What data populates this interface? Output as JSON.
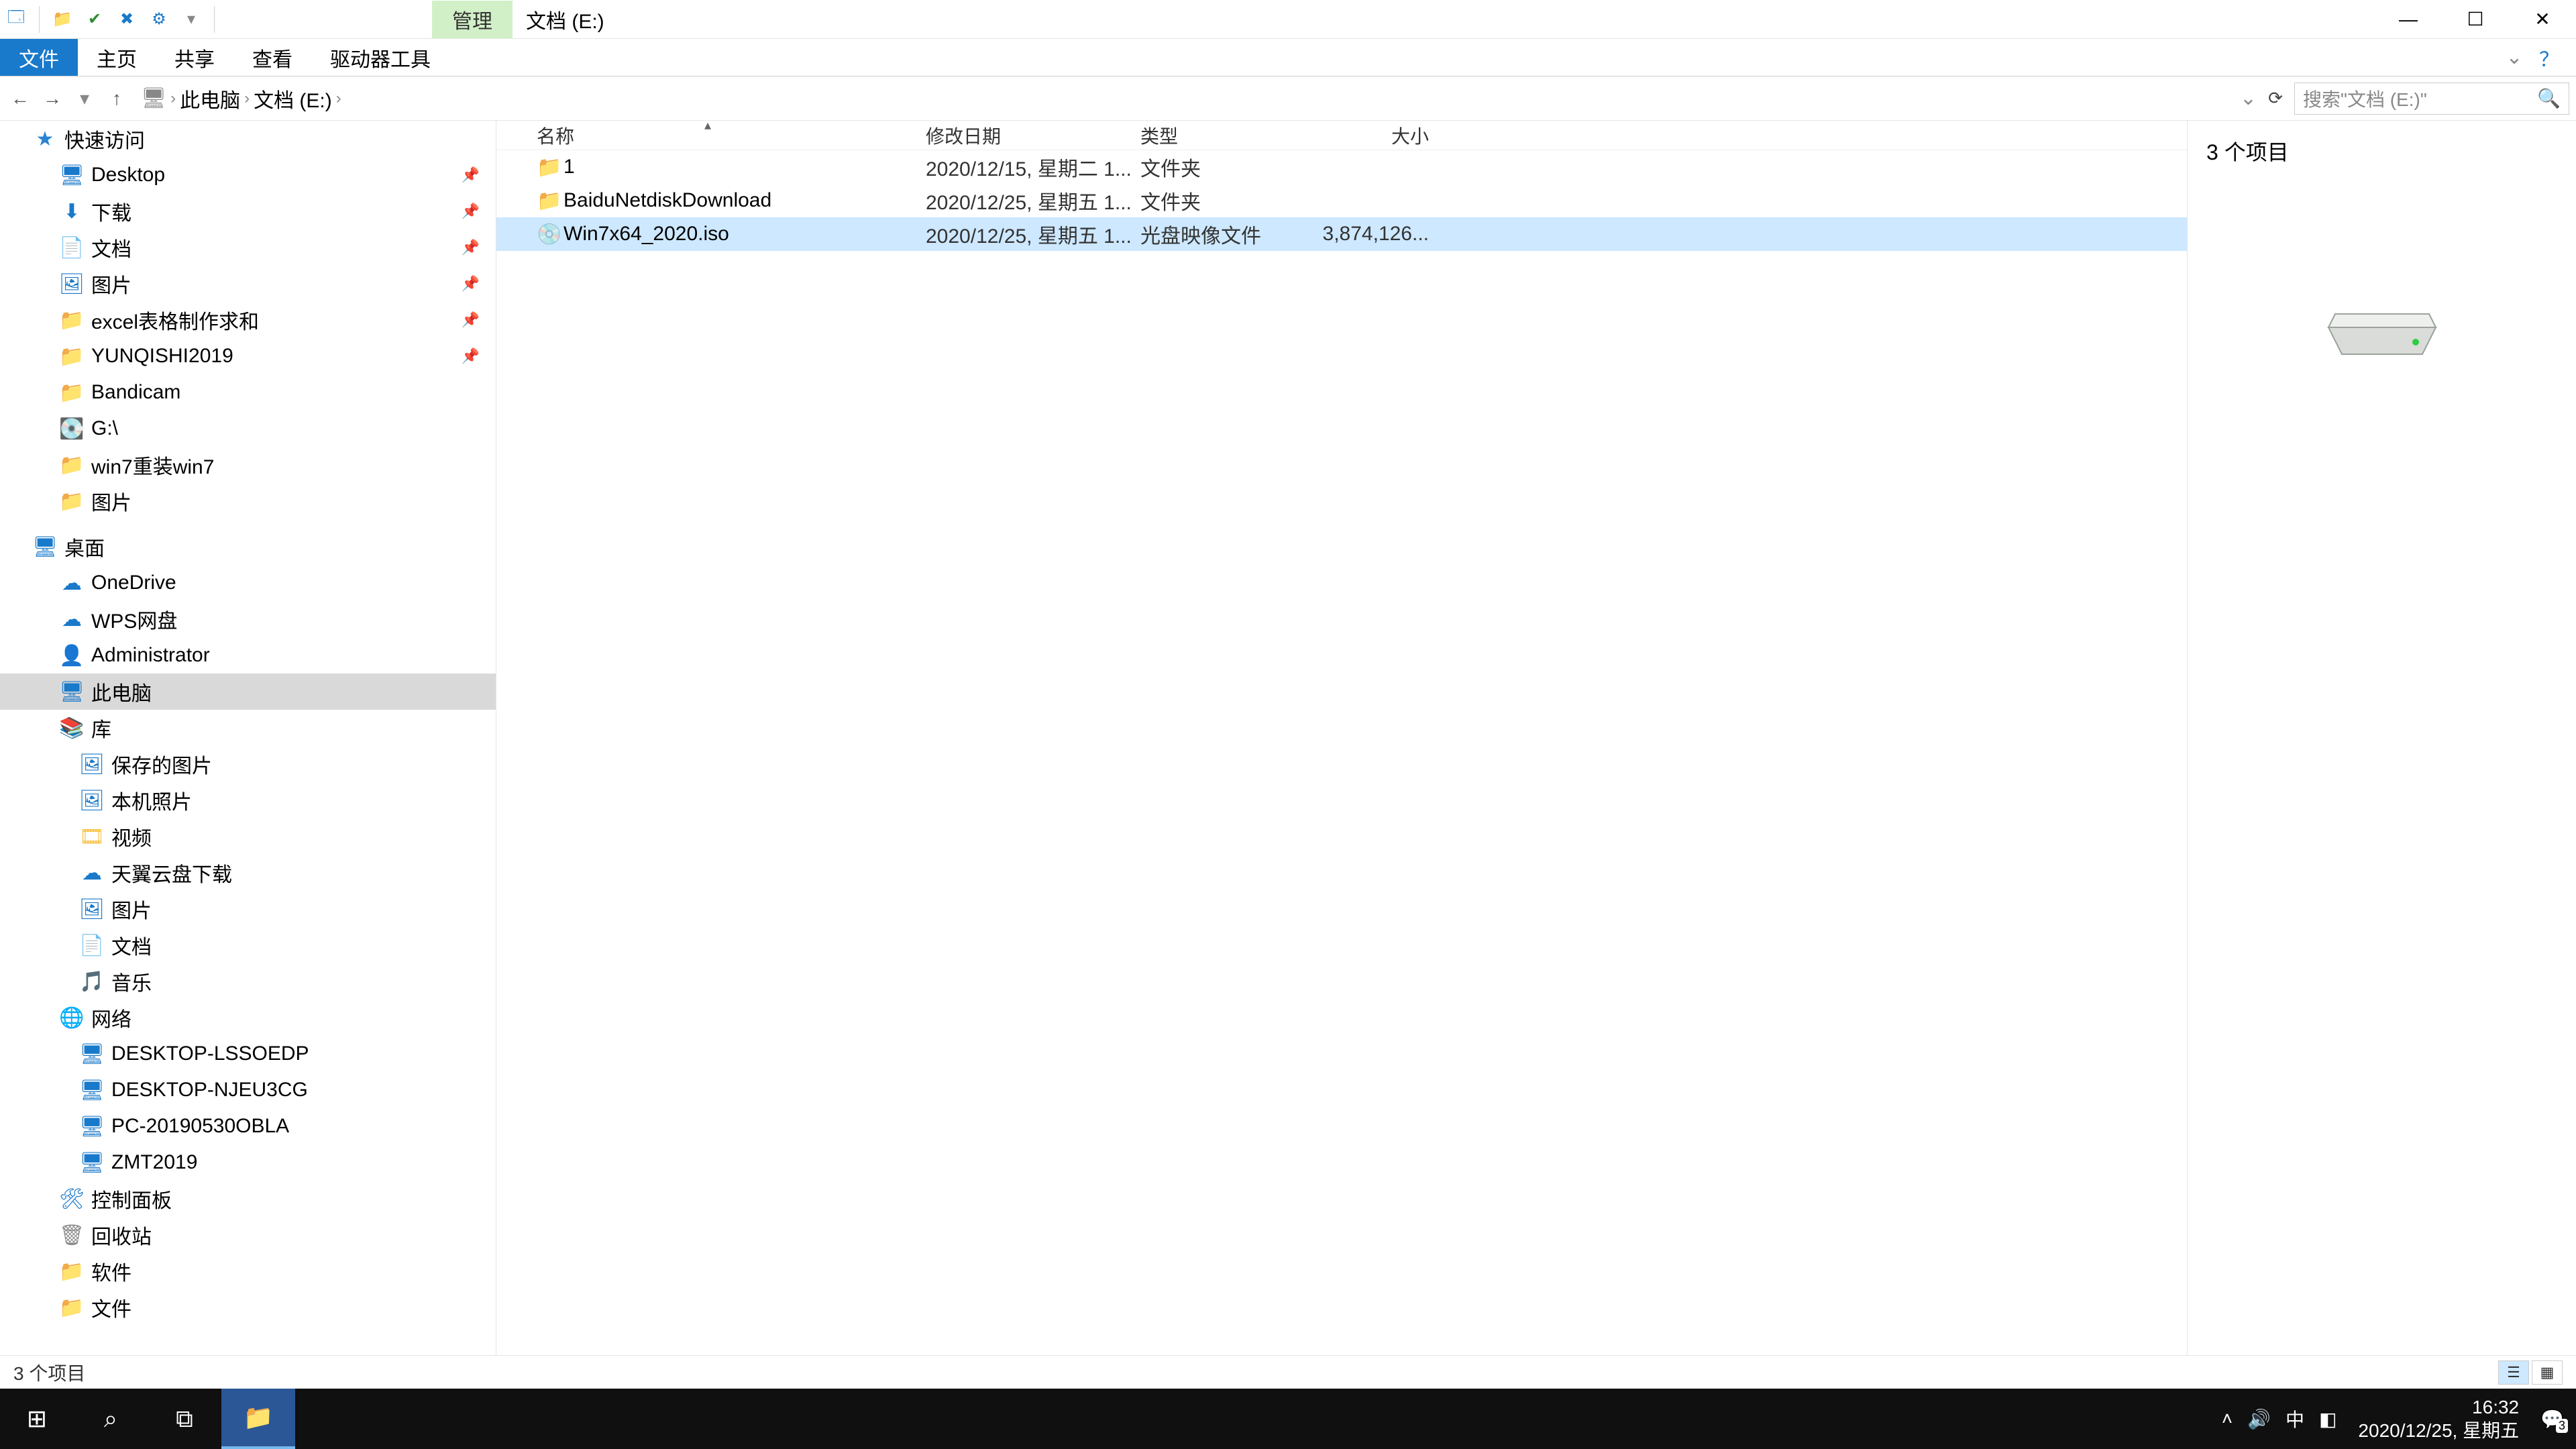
{
  "titlebar": {
    "contextual_tab": "管理",
    "location_caption": "文档 (E:)"
  },
  "ribbon": {
    "file": "文件",
    "home": "主页",
    "share": "共享",
    "view": "查看",
    "drive_tools": "驱动器工具"
  },
  "breadcrumb": {
    "root": "此电脑",
    "drive": "文档 (E:)"
  },
  "search": {
    "placeholder": "搜索\"文档 (E:)\""
  },
  "tree": {
    "quick_access": "快速访问",
    "desktop": "Desktop",
    "downloads": "下载",
    "documents": "文档",
    "pictures": "图片",
    "excel": "excel表格制作求和",
    "yunqishi": "YUNQISHI2019",
    "bandicam": "Bandicam",
    "gdrive": "G:\\",
    "win7reinstall": "win7重装win7",
    "pictures2": "图片",
    "desktop_cn": "桌面",
    "onedrive": "OneDrive",
    "wps": "WPS网盘",
    "admin": "Administrator",
    "this_pc": "此电脑",
    "library": "库",
    "saved_pics": "保存的图片",
    "camera_roll": "本机照片",
    "videos": "视频",
    "tianyi": "天翼云盘下载",
    "pictures3": "图片",
    "documents2": "文档",
    "music": "音乐",
    "network": "网络",
    "pc_lssoedp": "DESKTOP-LSSOEDP",
    "pc_njeu3cg": "DESKTOP-NJEU3CG",
    "pc_2019": "PC-20190530OBLA",
    "zmt": "ZMT2019",
    "control_panel": "控制面板",
    "recycle": "回收站",
    "software": "软件",
    "files": "文件"
  },
  "columns": {
    "name": "名称",
    "date": "修改日期",
    "type": "类型",
    "size": "大小"
  },
  "rows": [
    {
      "name": "1",
      "date": "2020/12/15, 星期二 1...",
      "type": "文件夹",
      "size": "",
      "icon": "folder"
    },
    {
      "name": "BaiduNetdiskDownload",
      "date": "2020/12/25, 星期五 1...",
      "type": "文件夹",
      "size": "",
      "icon": "folder"
    },
    {
      "name": "Win7x64_2020.iso",
      "date": "2020/12/25, 星期五 1...",
      "type": "光盘映像文件",
      "size": "3,874,126...",
      "icon": "disc",
      "selected": true
    }
  ],
  "preview": {
    "count_label": "3 个项目"
  },
  "status": {
    "text": "3 个项目"
  },
  "taskbar": {
    "time": "16:32",
    "date": "2020/12/25, 星期五",
    "ime": "中",
    "notification_badge": "3"
  }
}
